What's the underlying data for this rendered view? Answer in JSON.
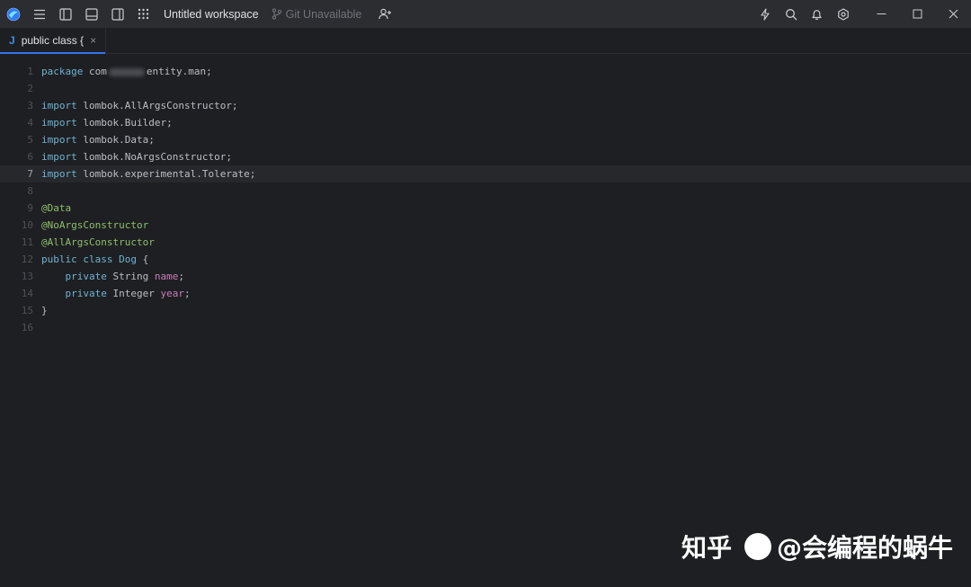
{
  "titlebar": {
    "workspace_title": "Untitled workspace",
    "git_status": "Git Unavailable",
    "icons": [
      "app-logo",
      "hamburger-menu-icon",
      "toggle-left-panel-icon",
      "toggle-bottom-panel-icon",
      "toggle-right-panel-icon",
      "apps-grid-icon",
      "git-branch-icon",
      "add-person-icon",
      "lightning-icon",
      "search-icon",
      "bell-icon",
      "settings-icon",
      "minimize-icon",
      "maximize-icon",
      "close-icon"
    ]
  },
  "tabs": [
    {
      "type": "J",
      "label": "public class {",
      "close": "×",
      "active": true
    }
  ],
  "editor": {
    "current_line": 7,
    "lines": [
      {
        "n": "1",
        "tokens": [
          {
            "c": "kw",
            "t": "package"
          },
          {
            "c": "pl",
            "t": " com"
          },
          {
            "c": "blur",
            "t": ""
          },
          {
            "c": "pl",
            "t": "entity.man;"
          }
        ]
      },
      {
        "n": "2",
        "tokens": []
      },
      {
        "n": "3",
        "tokens": [
          {
            "c": "kw",
            "t": "import"
          },
          {
            "c": "pl",
            "t": " lombok.AllArgsConstructor;"
          }
        ]
      },
      {
        "n": "4",
        "tokens": [
          {
            "c": "kw",
            "t": "import"
          },
          {
            "c": "pl",
            "t": " lombok.Builder;"
          }
        ]
      },
      {
        "n": "5",
        "tokens": [
          {
            "c": "kw",
            "t": "import"
          },
          {
            "c": "pl",
            "t": " lombok.Data;"
          }
        ]
      },
      {
        "n": "6",
        "tokens": [
          {
            "c": "kw",
            "t": "import"
          },
          {
            "c": "pl",
            "t": " lombok.NoArgsConstructor;"
          }
        ]
      },
      {
        "n": "7",
        "tokens": [
          {
            "c": "kw",
            "t": "import"
          },
          {
            "c": "pl",
            "t": " lombok.experimental.Tolerate;"
          }
        ]
      },
      {
        "n": "8",
        "tokens": []
      },
      {
        "n": "9",
        "tokens": [
          {
            "c": "an",
            "t": "@Data"
          }
        ]
      },
      {
        "n": "10",
        "tokens": [
          {
            "c": "an",
            "t": "@NoArgsConstructor"
          }
        ]
      },
      {
        "n": "11",
        "tokens": [
          {
            "c": "an",
            "t": "@AllArgsConstructor"
          }
        ]
      },
      {
        "n": "12",
        "tokens": [
          {
            "c": "kw",
            "t": "public"
          },
          {
            "c": "pl",
            "t": " "
          },
          {
            "c": "kw",
            "t": "class"
          },
          {
            "c": "pl",
            "t": " "
          },
          {
            "c": "tp",
            "t": "Dog"
          },
          {
            "c": "pl",
            "t": " {"
          }
        ]
      },
      {
        "n": "13",
        "tokens": [
          {
            "c": "pl",
            "t": "    "
          },
          {
            "c": "kw",
            "t": "private"
          },
          {
            "c": "pl",
            "t": " String "
          },
          {
            "c": "fd",
            "t": "name"
          },
          {
            "c": "pl",
            "t": ";"
          }
        ]
      },
      {
        "n": "14",
        "tokens": [
          {
            "c": "pl",
            "t": "    "
          },
          {
            "c": "kw",
            "t": "private"
          },
          {
            "c": "pl",
            "t": " Integer "
          },
          {
            "c": "fd",
            "t": "year"
          },
          {
            "c": "pl",
            "t": ";"
          }
        ]
      },
      {
        "n": "15",
        "tokens": [
          {
            "c": "pl",
            "t": "}"
          }
        ]
      },
      {
        "n": "16",
        "tokens": []
      }
    ]
  },
  "watermark": {
    "site": "知乎",
    "author": "@会编程的蜗牛"
  },
  "colors": {
    "accent": "#3574f0",
    "background": "#1e1f22",
    "keyword": "#6fb3d2",
    "annotation": "#8fbf6a",
    "field": "#c77dbb"
  }
}
